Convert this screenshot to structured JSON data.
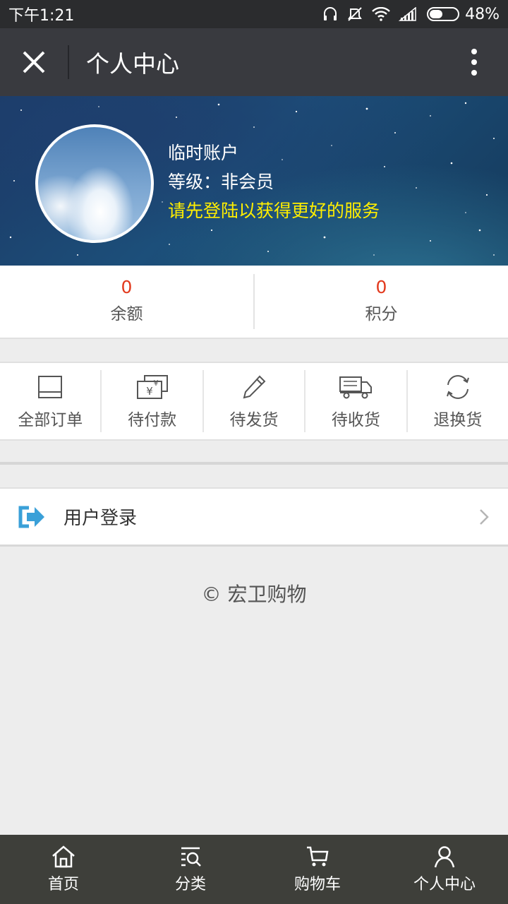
{
  "status_bar": {
    "time": "下午1:21",
    "battery_percent": "48%",
    "battery_level": 0.48,
    "icons": [
      "headset-icon",
      "mute-icon",
      "wifi-icon",
      "signal-icon",
      "battery-icon"
    ]
  },
  "header": {
    "title": "个人中心",
    "close_icon": "close-icon",
    "more_icon": "more-vertical-icon"
  },
  "profile": {
    "name": "临时账户",
    "level": "等级：非会员",
    "tip": "请先登陆以获得更好的服务",
    "tip_color": "#ffee00"
  },
  "stats": [
    {
      "value": "0",
      "label": "余额"
    },
    {
      "value": "0",
      "label": "积分"
    }
  ],
  "orders": [
    {
      "label": "全部订单",
      "icon": "all-orders-icon"
    },
    {
      "label": "待付款",
      "icon": "pending-payment-icon"
    },
    {
      "label": "待发货",
      "icon": "pending-shipment-icon"
    },
    {
      "label": "待收货",
      "icon": "pending-receipt-icon"
    },
    {
      "label": "退换货",
      "icon": "return-exchange-icon"
    }
  ],
  "login": {
    "label": "用户登录",
    "icon": "login-icon",
    "accent_color": "#3aa0d8"
  },
  "footer": {
    "copyright": "© 宏卫购物"
  },
  "tab_bar": [
    {
      "label": "首页",
      "icon": "home-icon"
    },
    {
      "label": "分类",
      "icon": "category-icon"
    },
    {
      "label": "购物车",
      "icon": "cart-icon"
    },
    {
      "label": "个人中心",
      "icon": "user-icon"
    }
  ],
  "colors": {
    "value_red": "#e2391d",
    "header_bg": "#393a3f",
    "tab_bar_bg": "#3e3f3a"
  }
}
